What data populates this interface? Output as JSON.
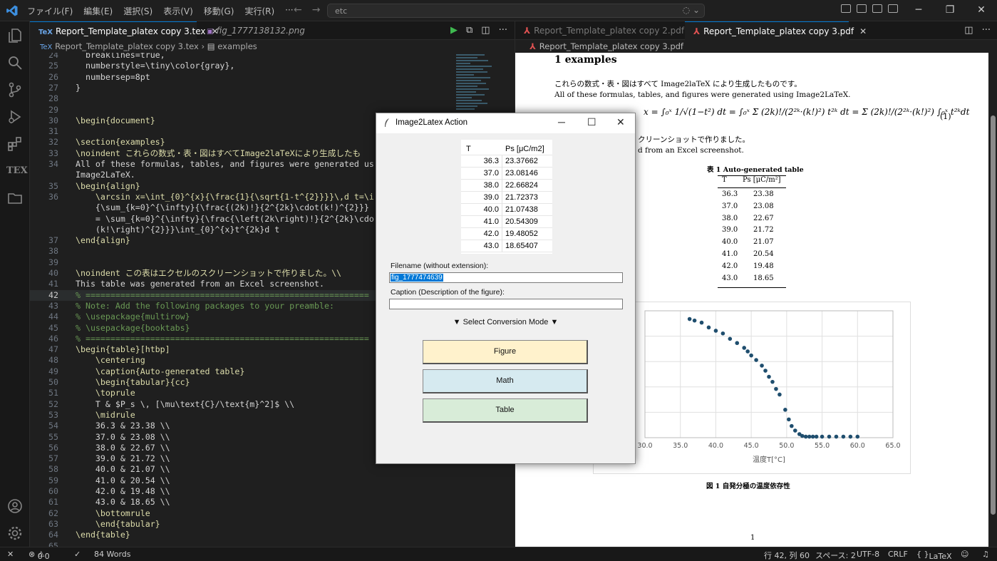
{
  "titlebar": {
    "menu": [
      "ファイル(F)",
      "編集(E)",
      "選択(S)",
      "表示(V)",
      "移動(G)",
      "実行(R)",
      "···"
    ],
    "command_center": "etc"
  },
  "editor": {
    "tabs": [
      {
        "label": "Report_Template_platex copy 3.tex",
        "icon": "TeX",
        "active": true
      },
      {
        "label": "fig_1777138132.png",
        "icon": "image-icon",
        "active": false
      }
    ],
    "breadcrumb": {
      "file": "Report_Template_platex copy 3.tex",
      "symbol": "examples"
    },
    "code_lines": [
      {
        "n": "24",
        "t": "  breaklines=true,"
      },
      {
        "n": "25",
        "t": "  numberstyle=\\tiny\\color{gray},"
      },
      {
        "n": "26",
        "t": "  numbersep=8pt"
      },
      {
        "n": "27",
        "t": "}"
      },
      {
        "n": "28",
        "t": ""
      },
      {
        "n": "29",
        "t": ""
      },
      {
        "n": "30",
        "t": "\\begin{document}"
      },
      {
        "n": "31",
        "t": ""
      },
      {
        "n": "32",
        "t": "\\section{examples}"
      },
      {
        "n": "33",
        "t": "\\noindent これらの数式・表・図はすべてImage2laTeXにより生成したも"
      },
      {
        "n": "34",
        "t": "All of these formulas, tables, and figures were generated us"
      },
      {
        "n": "",
        "t": "Image2LaTeX."
      },
      {
        "n": "35",
        "t": "\\begin{align}"
      },
      {
        "n": "36",
        "t": "    \\arcsin x=\\int_{0}^{x}{\\frac{1}{\\sqrt{1-t^{2}}}}\\,d t=\\i"
      },
      {
        "n": "",
        "t": "    {\\sum_{k=0}^{\\infty}{\\frac{(2k)!}{2^{2k}\\cdot(k!)^{2}}}"
      },
      {
        "n": "",
        "t": "    = \\sum_{k=0}^{\\infty}{\\frac{\\left(2k\\right)!}{2^{2k}\\cdo"
      },
      {
        "n": "",
        "t": "    (k!\\right)^{2}}}\\int_{0}^{x}t^{2k}d t"
      },
      {
        "n": "37",
        "t": "\\end{align}"
      },
      {
        "n": "38",
        "t": ""
      },
      {
        "n": "39",
        "t": ""
      },
      {
        "n": "40",
        "t": "\\noindent この表はエクセルのスクリーンショットで作りました。\\\\"
      },
      {
        "n": "41",
        "t": "This table was generated from an Excel screenshot."
      },
      {
        "n": "42",
        "t": "% ========================================================="
      },
      {
        "n": "43",
        "t": "% Note: Add the following packages to your preamble:"
      },
      {
        "n": "44",
        "t": "% \\usepackage{multirow}"
      },
      {
        "n": "45",
        "t": "% \\usepackage{booktabs}"
      },
      {
        "n": "46",
        "t": "% ========================================================="
      },
      {
        "n": "47",
        "t": "\\begin{table}[htbp]"
      },
      {
        "n": "48",
        "t": "    \\centering"
      },
      {
        "n": "49",
        "t": "    \\caption{Auto-generated table}"
      },
      {
        "n": "50",
        "t": "    \\begin{tabular}{cc}"
      },
      {
        "n": "51",
        "t": "    \\toprule"
      },
      {
        "n": "52",
        "t": "    T & $P_s \\, [\\mu\\text{C}/\\text{m}^2]$ \\\\"
      },
      {
        "n": "53",
        "t": "    \\midrule"
      },
      {
        "n": "54",
        "t": "    36.3 & 23.38 \\\\"
      },
      {
        "n": "55",
        "t": "    37.0 & 23.08 \\\\"
      },
      {
        "n": "56",
        "t": "    38.0 & 22.67 \\\\"
      },
      {
        "n": "57",
        "t": "    39.0 & 21.72 \\\\"
      },
      {
        "n": "58",
        "t": "    40.0 & 21.07 \\\\"
      },
      {
        "n": "59",
        "t": "    41.0 & 20.54 \\\\"
      },
      {
        "n": "60",
        "t": "    42.0 & 19.48 \\\\"
      },
      {
        "n": "61",
        "t": "    43.0 & 18.65 \\\\"
      },
      {
        "n": "62",
        "t": "    \\bottomrule"
      },
      {
        "n": "63",
        "t": "    \\end{tabular}"
      },
      {
        "n": "64",
        "t": "\\end{table}"
      },
      {
        "n": "65",
        "t": ""
      }
    ]
  },
  "pdf": {
    "tabs": [
      {
        "label": "Report_Template_platex copy 2.pdf",
        "active": false
      },
      {
        "label": "Report_Template_platex copy 3.pdf",
        "active": true
      }
    ],
    "breadcrumb": "Report_Template_platex copy 3.pdf",
    "section": "1   examples",
    "para1_jp": "これらの数式・表・図はすべて Image2laTeX により生成したものです。",
    "para1_en": "All of these formulas, tables, and figures were generated using Image2LaTeX.",
    "eq_number": "(1)",
    "para2_jp_fragment": "クリーンショットで作りました。",
    "para2_en_fragment": "d from an Excel screenshot.",
    "table_caption": "表 1   Auto-generated table",
    "table_header": [
      "T",
      "Ps [μC/m²]"
    ],
    "table_rows": [
      [
        "36.3",
        "23.38"
      ],
      [
        "37.0",
        "23.08"
      ],
      [
        "38.0",
        "22.67"
      ],
      [
        "39.0",
        "21.72"
      ],
      [
        "40.0",
        "21.07"
      ],
      [
        "41.0",
        "20.54"
      ],
      [
        "42.0",
        "19.48"
      ],
      [
        "43.0",
        "18.65"
      ]
    ],
    "figure_caption": "図 1   自発分極の温度依存性",
    "page_number": "1"
  },
  "chart_data": {
    "type": "scatter",
    "xlabel": "温度T[°C]",
    "ylabel": "",
    "xlim": [
      30,
      65
    ],
    "xticks": [
      "30.0",
      "35.0",
      "40.0",
      "45.0",
      "50.0",
      "55.0",
      "60.0",
      "65.0"
    ],
    "ylim": [
      0,
      25
    ],
    "grid": true,
    "color": "#1f4e6e",
    "points": [
      [
        36.3,
        23.38
      ],
      [
        37.0,
        23.08
      ],
      [
        38.0,
        22.67
      ],
      [
        39.0,
        21.72
      ],
      [
        40.0,
        21.07
      ],
      [
        41.0,
        20.54
      ],
      [
        42.0,
        19.48
      ],
      [
        43.0,
        18.65
      ],
      [
        44.0,
        17.7
      ],
      [
        44.5,
        17.0
      ],
      [
        45.0,
        16.2
      ],
      [
        45.7,
        15.3
      ],
      [
        46.5,
        14.2
      ],
      [
        47.0,
        13.2
      ],
      [
        47.5,
        12.0
      ],
      [
        48.0,
        11.0
      ],
      [
        48.5,
        9.6
      ],
      [
        49.0,
        8.5
      ],
      [
        49.8,
        5.5
      ],
      [
        50.3,
        3.6
      ],
      [
        50.7,
        2.3
      ],
      [
        51.2,
        1.4
      ],
      [
        51.8,
        0.7
      ],
      [
        52.2,
        0.35
      ],
      [
        52.7,
        0.2
      ],
      [
        53.2,
        0.2
      ],
      [
        53.7,
        0.2
      ],
      [
        54.2,
        0.2
      ],
      [
        55.0,
        0.2
      ],
      [
        56.0,
        0.2
      ],
      [
        57.0,
        0.2
      ],
      [
        58.0,
        0.2
      ],
      [
        59.0,
        0.2
      ],
      [
        60.0,
        0.2
      ]
    ]
  },
  "dialog": {
    "title": "Image2Latex Action",
    "table_header": [
      "T",
      "Ps [μC/m2]"
    ],
    "table_rows": [
      [
        "36.3",
        "23.37662"
      ],
      [
        "37.0",
        "23.08146"
      ],
      [
        "38.0",
        "22.66824"
      ],
      [
        "39.0",
        "21.72373"
      ],
      [
        "40.0",
        "21.07438"
      ],
      [
        "41.0",
        "20.54309"
      ],
      [
        "42.0",
        "19.48052"
      ],
      [
        "43.0",
        "18.65407"
      ]
    ],
    "filename_label": "Filename (without extension):",
    "filename_value": "fig_1777474639",
    "caption_label": "Caption (Description of the figure):",
    "caption_value": "",
    "mode_label": "▼ Select Conversion Mode ▼",
    "buttons": [
      {
        "label": "Figure",
        "color": "#fff2cc"
      },
      {
        "label": "Math",
        "color": "#d6eaf0"
      },
      {
        "label": "Table",
        "color": "#d8ecd8"
      }
    ]
  },
  "status": {
    "errors": "0",
    "warnings": "0",
    "words": "84 Words",
    "position": "行 42, 列 60",
    "spaces": "スペース: 2",
    "encoding": "UTF-8",
    "eol": "CRLF",
    "language": "LaTeX"
  }
}
